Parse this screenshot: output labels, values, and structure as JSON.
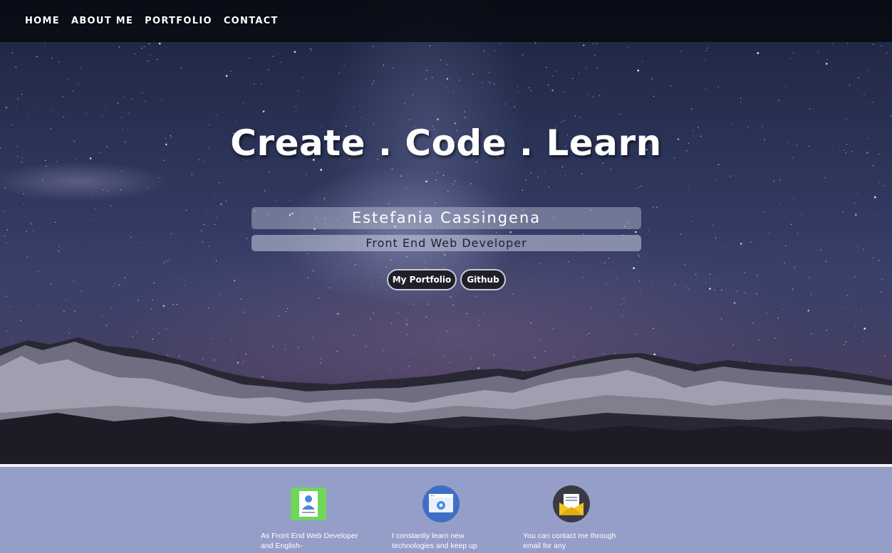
{
  "nav": {
    "items": [
      {
        "label": "HOME"
      },
      {
        "label": "ABOUT ME"
      },
      {
        "label": "PORTFOLIO"
      },
      {
        "label": "CONTACT"
      }
    ]
  },
  "hero": {
    "headline": "Create . Code . Learn",
    "name": "Estefania Cassingena",
    "role": "Front End Web Developer",
    "buttons": {
      "portfolio_label": "My Portfolio",
      "github_label": "Github"
    }
  },
  "features": [
    {
      "icon": "profile-card-icon",
      "text": "As Front End Web Developer and English-"
    },
    {
      "icon": "browser-settings-icon",
      "text": "I constantly learn new technologies and keep up"
    },
    {
      "icon": "envelope-icon",
      "text": "You can contact me through email for any"
    }
  ],
  "colors": {
    "navbar": "#06080e",
    "features_bg": "#959ec9",
    "button_bg": "#1e1f28",
    "icon_green": "#6fd65a",
    "icon_blue": "#3f6fc4",
    "icon_yellow": "#f2c522"
  }
}
